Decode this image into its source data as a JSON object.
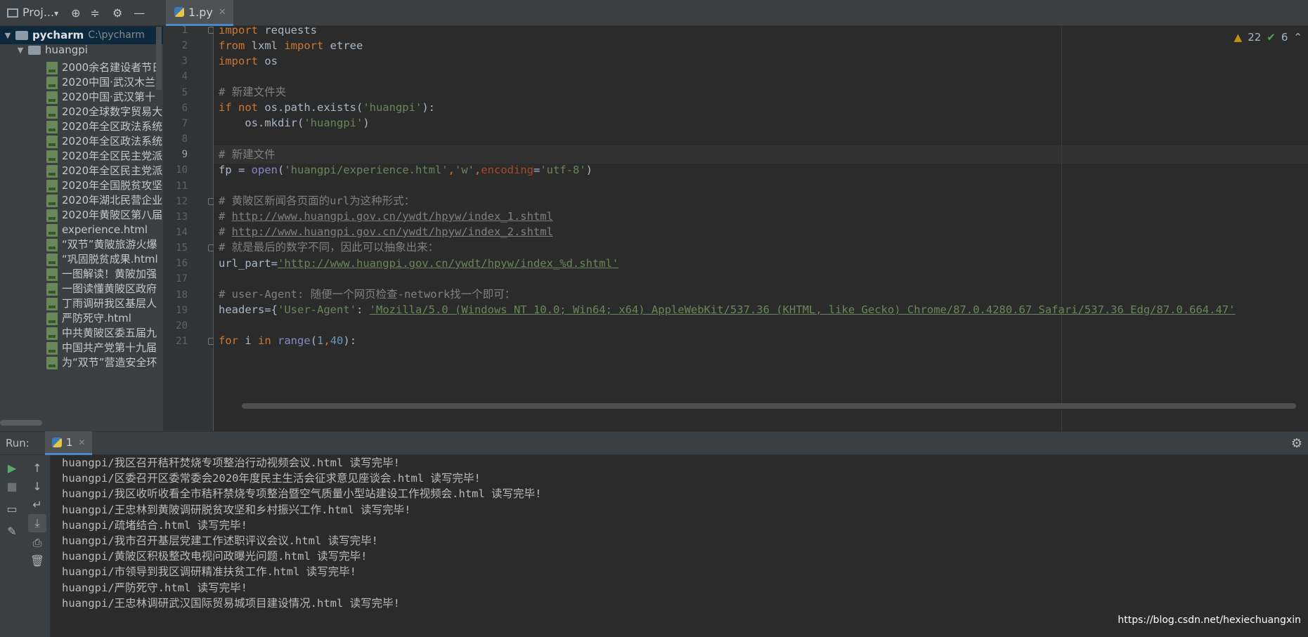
{
  "project_header": {
    "label": "Proj...",
    "dropdown": "▾"
  },
  "editor_tab": {
    "name": "1.py"
  },
  "tree": {
    "root": {
      "name": "pycharm",
      "path": "C:\\pycharm"
    },
    "folder": "huangpi",
    "files": [
      "2000余名建设者节日",
      "2020中国·武汉木兰",
      "2020中国·武汉第十",
      "2020全球数字贸易大",
      "2020年全区政法系统",
      "2020年全区政法系统",
      "2020年全区民主党派",
      "2020年全区民主党派",
      "2020年全国脱贫攻坚",
      "2020年湖北民营企业",
      "2020年黄陂区第八届",
      "experience.html",
      "“双节”黄陂旅游火爆",
      "“巩固脱贫成果.html",
      "一图解读！黄陂加强",
      "一图读懂黄陂区政府",
      "丁雨调研我区基层人",
      "严防死守.html",
      "中共黄陂区委五届九",
      "中国共产党第十九届",
      "为“双节”营造安全环"
    ]
  },
  "inspection": {
    "warnings": "22",
    "ok": "6"
  },
  "code": {
    "line_numbers": [
      "1",
      "2",
      "3",
      "4",
      "5",
      "6",
      "7",
      "8",
      "9",
      "10",
      "11",
      "12",
      "13",
      "14",
      "15",
      "16",
      "17",
      "18",
      "19",
      "20",
      "21"
    ],
    "current_line": "9",
    "l1_kw": "import",
    "l1_rest": " requests",
    "l2_kw1": "from",
    "l2_mid": " lxml ",
    "l2_kw2": "import",
    "l2_rest": " etree",
    "l3_kw": "import",
    "l3_rest": " os",
    "l5_cm": "# 新建文件夹",
    "l6_kw": "if not",
    "l6_a": " os.path.exists(",
    "l6_str": "'huangpi'",
    "l6_b": "):",
    "l7_a": "    os.mkdir(",
    "l7_str": "'huangpi'",
    "l7_b": ")",
    "l9_cm": "# 新建文件",
    "l10_a": "fp = ",
    "l10_bi": "open",
    "l10_b": "(",
    "l10_s1": "'huangpi/experience.html'",
    "l10_c1": ",",
    "l10_s2": "'w'",
    "l10_c2": ",",
    "l10_param": "encoding",
    "l10_eq": "=",
    "l10_s3": "'utf-8'",
    "l10_end": ")",
    "l12_cm": "# 黄陂区新闻各页面的url为这种形式：",
    "l13_cm": "# ",
    "l13_link": "http://www.huangpi.gov.cn/ywdt/hpyw/index_1.shtml",
    "l14_cm": "# ",
    "l14_link": "http://www.huangpi.gov.cn/ywdt/hpyw/index_2.shtml",
    "l15_cm": "# 就是最后的数字不同，因此可以抽象出来：",
    "l16_a": "url_part",
    "l16_eq": "=",
    "l16_str": "'http://www.huangpi.gov.cn/ywdt/hpyw/index_%d.shtml'",
    "l18_cm": "# user-Agent: 随便一个网页检查-network找一个即可：",
    "l19_a": "headers",
    "l19_eq": "=",
    "l19_b": "{",
    "l19_key": "'User-Agent'",
    "l19_c": ": ",
    "l19_val": "'Mozilla/5.0 (Windows NT 10.0; Win64; x64) AppleWebKit/537.36 (KHTML, like Gecko) Chrome/87.0.4280.67 Safari/537.36 Edg/87.0.664.47'",
    "l21_kw1": "for",
    "l21_a": " i ",
    "l21_kw2": "in",
    "l21_sp": " ",
    "l21_bi": "range",
    "l21_b": "(",
    "l21_n1": "1",
    "l21_c": ",",
    "l21_n2": "40",
    "l21_end": "):"
  },
  "run": {
    "label": "Run:",
    "tab": "1",
    "output": [
      "huangpi/我区召开秸秆焚烧专项整治行动视频会议.html 读写完毕!",
      "huangpi/区委召开区委常委会2020年度民主生活会征求意见座谈会.html 读写完毕!",
      "huangpi/我区收听收看全市秸秆禁烧专项整治暨空气质量小型站建设工作视频会.html 读写完毕!",
      "huangpi/王忠林到黄陂调研脱贫攻坚和乡村振兴工作.html 读写完毕!",
      "huangpi/疏堵结合.html 读写完毕!",
      "huangpi/我市召开基层党建工作述职评议会议.html 读写完毕!",
      "huangpi/黄陂区积极整改电视问政曝光问题.html 读写完毕!",
      "huangpi/市领导到我区调研精准扶贫工作.html 读写完毕!",
      "huangpi/严防死守.html 读写完毕!",
      "huangpi/王忠林调研武汉国际贸易城项目建设情况.html 读写完毕!"
    ]
  },
  "watermark": "https://blog.csdn.net/hexiechuangxin"
}
